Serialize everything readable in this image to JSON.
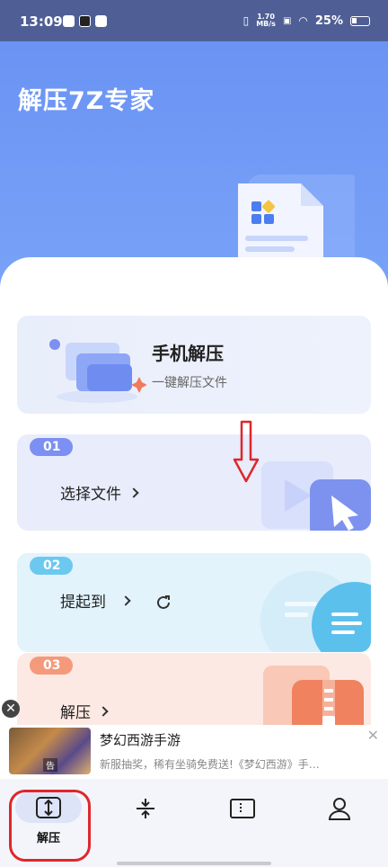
{
  "status_bar": {
    "time": "13:09",
    "net_speed_value": "1.70",
    "net_speed_unit": "MB/s",
    "battery": "25%"
  },
  "app": {
    "title": "解压7Z专家"
  },
  "phone_card": {
    "title": "手机解压",
    "subtitle": "一键解压文件"
  },
  "steps": [
    {
      "num": "01",
      "label": "选择文件",
      "color": "#7c8ff2"
    },
    {
      "num": "02",
      "label": "提起到",
      "color": "#6cc8ef"
    },
    {
      "num": "03",
      "label": "解压",
      "color": "#f49a7a"
    }
  ],
  "ad": {
    "title": "梦幻西游手游",
    "desc": "新服抽奖，稀有坐骑免费送!《梦幻西游》手…",
    "tag": "告"
  },
  "tabs": [
    {
      "label": "解压",
      "icon": "unzip-icon",
      "active": true
    },
    {
      "label": "",
      "icon": "compress-icon",
      "active": false
    },
    {
      "label": "",
      "icon": "file-zip-icon",
      "active": false
    },
    {
      "label": "",
      "icon": "profile-icon",
      "active": false
    }
  ],
  "colors": {
    "primary": "#6a93f4",
    "annotation": "#e0262b"
  }
}
